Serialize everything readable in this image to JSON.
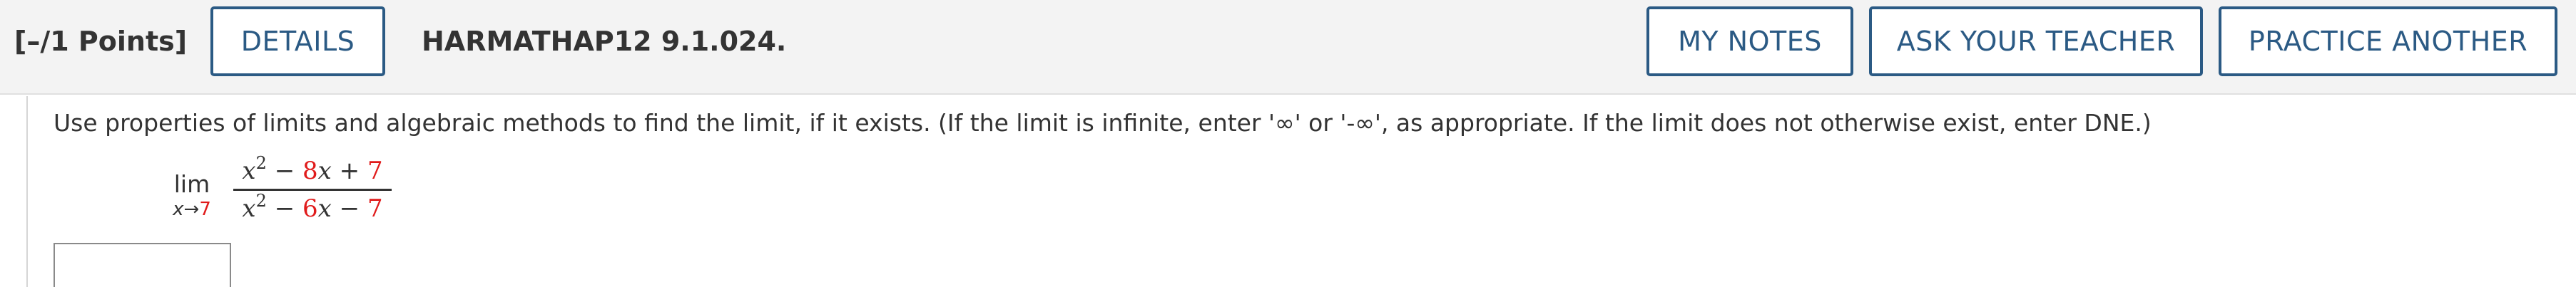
{
  "header": {
    "points_label": "[–/1 Points]",
    "details_button": "DETAILS",
    "problem_id": "HARMATHAP12 9.1.024.",
    "my_notes_button": "MY NOTES",
    "ask_teacher_button": "ASK YOUR TEACHER",
    "practice_another_button": "PRACTICE ANOTHER"
  },
  "problem": {
    "instructions": "Use properties of limits and algebraic methods to find the limit, if it exists. (If the limit is infinite, enter '∞' or '-∞', as appropriate. If the limit does not otherwise exist, enter DNE.)",
    "lim_word": "lim",
    "lim_var": "x",
    "lim_arrow": "→",
    "lim_value": "7",
    "numerator": {
      "var": "x",
      "exp": "2",
      "op1": " − ",
      "coef": "8",
      "var2": "x",
      "op2": " + ",
      "const": "7"
    },
    "denominator": {
      "var": "x",
      "exp": "2",
      "op1": " − ",
      "coef": "6",
      "var2": "x",
      "op2": " − ",
      "const": "7"
    },
    "answer_value": ""
  },
  "colors": {
    "accent": "#2b5a84",
    "highlight_number": "#e01b1b",
    "header_bg": "#f3f3f3",
    "text": "#333333"
  }
}
